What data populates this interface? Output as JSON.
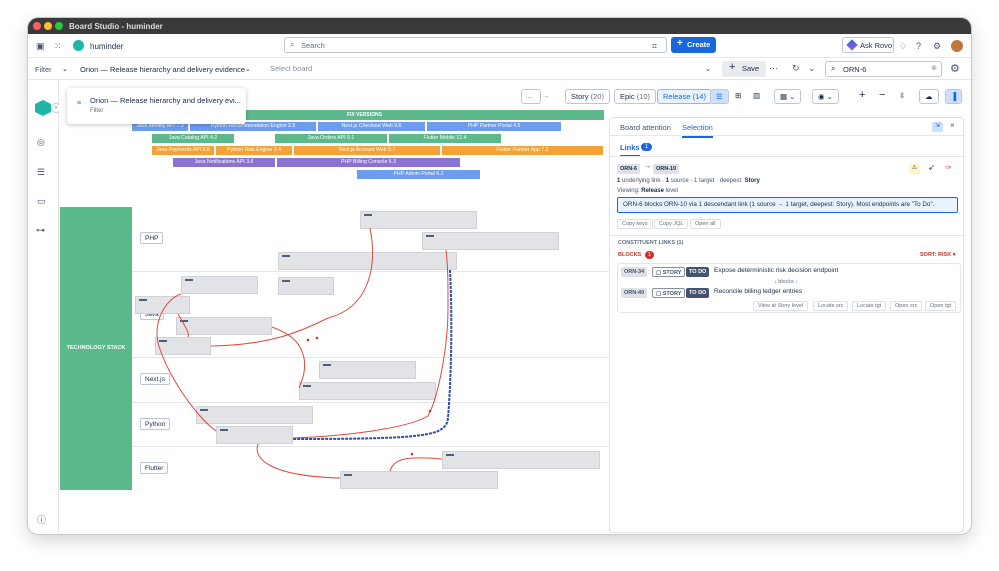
{
  "window": {
    "title": "Board Studio - huminder"
  },
  "topnav": {
    "workspace": "huminder",
    "search_placeholder": "Search",
    "create_label": "Create",
    "ask_rovo": "Ask Rovo"
  },
  "filterbar": {
    "filter_label": "Filter",
    "board_name": "Orion — Release hierarchy and delivery evidence",
    "select_board": "Select board",
    "save_label": "Save",
    "search_value": "ORN-6"
  },
  "tooltip": {
    "title": "Orion — Release hierarchy and delivery evi...",
    "sub": "Filter"
  },
  "view_tabs": [
    {
      "label": "Story",
      "count": "(20)"
    },
    {
      "label": "Epic",
      "count": "(10)"
    },
    {
      "label": "Release",
      "count": "(14)"
    }
  ],
  "fix_versions": {
    "header": "FIX VERSIONS",
    "bars": [
      {
        "label": "Java Identity API 7.3",
        "color": "#6b9cf0"
      },
      {
        "label": "Python Recommendation Engine 2.9",
        "color": "#6b9cf0"
      },
      {
        "label": "Next.js Checkout Web 9.6",
        "color": "#6b9cf0"
      },
      {
        "label": "PHP Partner Portal 4.5",
        "color": "#6b9cf0"
      },
      {
        "label": "Java Catalog API 4.2",
        "color": "#5bb98c"
      },
      {
        "label": "Java Orders API 9.1",
        "color": "#5bb98c"
      },
      {
        "label": "Flutter Mobile 12.4",
        "color": "#5bb98c"
      },
      {
        "label": "Java Payments API 5.8",
        "color": "#f4a236"
      },
      {
        "label": "Python Risk Engine 3.4",
        "color": "#f4a236"
      },
      {
        "label": "Next.js Account Web 9.7",
        "color": "#f4a236"
      },
      {
        "label": "Flutter Partner App 7.2",
        "color": "#f4a236"
      },
      {
        "label": "Java Notifications API 3.6",
        "color": "#8b72d1"
      },
      {
        "label": "PHP Billing Console 6.3",
        "color": "#8b72d1"
      },
      {
        "label": "PHP Admin Portal 6.2",
        "color": "#6b9cf0"
      }
    ]
  },
  "tech_stack": {
    "label": "TECHNOLOGY STACK",
    "lanes": [
      "PHP",
      "Java",
      "Next.js",
      "Python",
      "Flutter"
    ]
  },
  "panel": {
    "tabs": [
      "Board attention",
      "Selection"
    ],
    "links_label": "Links",
    "links_count": "1",
    "from_key": "ORN-6",
    "to_key": "ORN-10",
    "summary_parts": [
      "1",
      "underlying link · ",
      "1",
      "source · 1 target · deepest: ",
      "Story"
    ],
    "viewing_prefix": "Viewing: ",
    "viewing_level": "Release",
    "viewing_suffix": " level",
    "highlight": "ORN-6 blocks ORN-10 via 1 descendant link (1 source → 1 target, deepest: Story). Most endpoints are \"To Do\".",
    "actions": [
      "Copy keys",
      "Copy JQL",
      "Open all"
    ],
    "constituent": "CONSTITUENT LINKS (1)",
    "blocks_label": "BLOCKS",
    "blocks_count": "1",
    "sort_label": "SORT: RISK ▾",
    "link": {
      "src_key": "ORN-34",
      "src_type": "STORY",
      "src_status": "TO DO",
      "src_title": "Expose deterministic risk decision endpoint",
      "relation": "↓ blocks ↓",
      "tgt_key": "ORN-40",
      "tgt_type": "STORY",
      "tgt_status": "TO DO",
      "tgt_title": "Reconcile billing ledger entries"
    },
    "row_actions": [
      "View at Story level",
      "Locate src",
      "Locate tgt",
      "Open src",
      "Open tgt"
    ]
  },
  "colors": {
    "accent": "#1868db",
    "lane_green": "#5bb98c",
    "link_red": "#e2483d",
    "path_blue": "#2c4fa8"
  }
}
